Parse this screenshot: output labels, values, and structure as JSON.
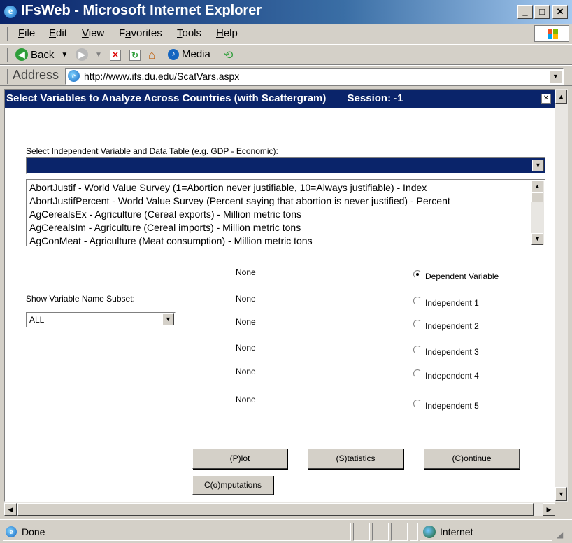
{
  "window": {
    "title": "IFsWeb - Microsoft Internet Explorer",
    "minimize": "_",
    "maximize": "□",
    "close": "✕"
  },
  "menu": [
    {
      "key": "F",
      "rest": "ile"
    },
    {
      "key": "E",
      "rest": "dit"
    },
    {
      "key": "V",
      "rest": "iew"
    },
    {
      "key": "a",
      "pre": "F",
      "rest": "vorites"
    },
    {
      "key": "T",
      "rest": "ools"
    },
    {
      "key": "H",
      "rest": "elp"
    }
  ],
  "toolbar": {
    "back_label": "Back",
    "media_label": "Media"
  },
  "address": {
    "label": "Address",
    "url": "http://www.ifs.du.edu/ScatVars.aspx"
  },
  "page": {
    "title": "Select Variables to Analyze Across Countries (with Scattergram)",
    "session": "Session: -1",
    "close_glyph": "✕",
    "select_label": "Select Independent Variable and Data Table (e.g. GDP - Economic):",
    "dropdown_selected": "",
    "variables": [
      "AbortJustif - World Value Survey (1=Abortion never justifiable, 10=Always justifiable) - Index",
      "AbortJustifPercent - World Value Survey (Percent saying that abortion is never justified) - Percent",
      "AgCerealsEx - Agriculture (Cereal exports) - Million metric tons",
      "AgCerealsIm - Agriculture (Cereal imports) - Million metric tons",
      "AgConMeat - Agriculture (Meat consumption) - Million metric tons"
    ],
    "subset_label": "Show Variable Name Subset:",
    "subset_value": "ALL",
    "assignments": [
      {
        "value": "None",
        "label": "Dependent Variable",
        "checked": true
      },
      {
        "value": "None",
        "label": "Independent 1",
        "checked": false
      },
      {
        "value": "None",
        "label": "Independent 2",
        "checked": false
      },
      {
        "value": "None",
        "label": "Independent 3",
        "checked": false
      },
      {
        "value": "None",
        "label": "Independent 4",
        "checked": false
      },
      {
        "value": "None",
        "label": "Independent 5",
        "checked": false
      }
    ],
    "buttons": {
      "plot": "(P)lot",
      "statistics": "(S)tatistics",
      "continue": "(C)ontinue",
      "computations": "C(o)mputations"
    }
  },
  "status": {
    "text": "Done",
    "zone": "Internet"
  },
  "colors": {
    "titlebar": "#0a246a",
    "page_header": "#0a246a",
    "chrome": "#d4d0c8"
  }
}
